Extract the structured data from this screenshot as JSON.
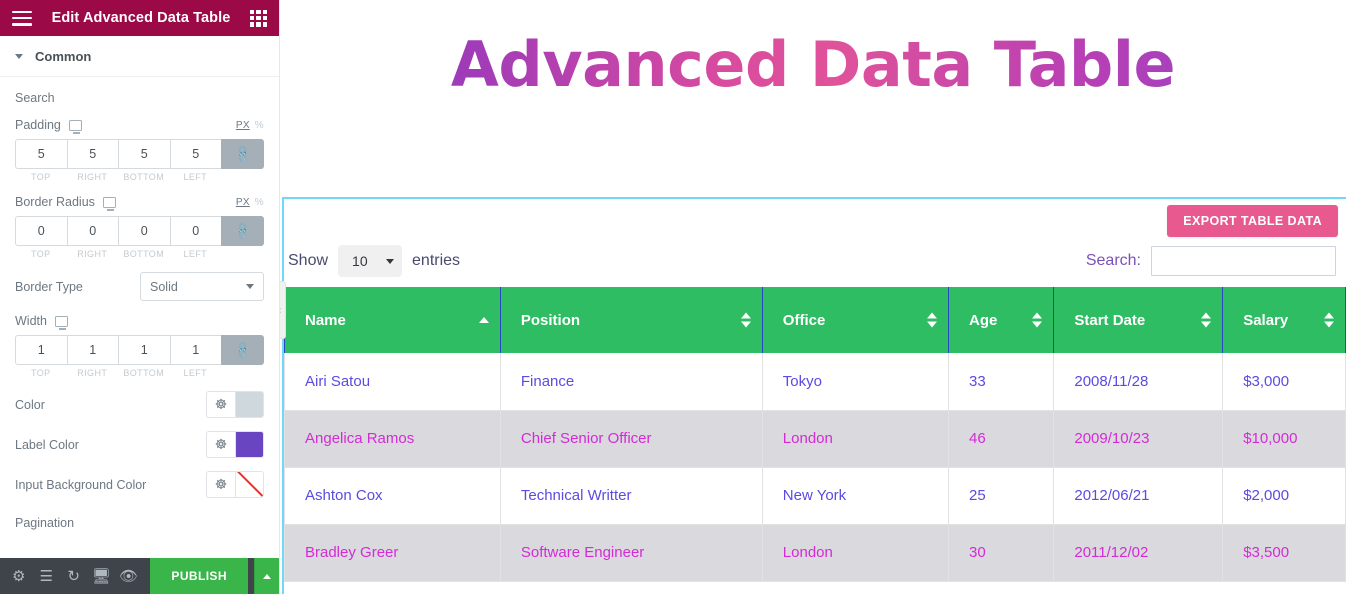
{
  "panel": {
    "title": "Edit Advanced Data Table",
    "menu_icon": "hamburger-icon",
    "grid_icon": "grid-icon",
    "section": {
      "label": "Common"
    },
    "groups": {
      "search": "Search",
      "pagination": "Pagination"
    },
    "controls": {
      "padding": {
        "label": "Padding",
        "unit_px": "PX",
        "unit_pct": "%",
        "values": [
          "5",
          "5",
          "5",
          "5"
        ],
        "sides": [
          "TOP",
          "RIGHT",
          "BOTTOM",
          "LEFT"
        ]
      },
      "border_radius": {
        "label": "Border Radius",
        "unit_px": "PX",
        "unit_pct": "%",
        "values": [
          "0",
          "0",
          "0",
          "0"
        ],
        "sides": [
          "TOP",
          "RIGHT",
          "BOTTOM",
          "LEFT"
        ]
      },
      "border_type": {
        "label": "Border Type",
        "value": "Solid"
      },
      "width": {
        "label": "Width",
        "values": [
          "1",
          "1",
          "1",
          "1"
        ],
        "sides": [
          "TOP",
          "RIGHT",
          "BOTTOM",
          "LEFT"
        ]
      },
      "color": {
        "label": "Color",
        "swatch": "#cfd8dd"
      },
      "label_color": {
        "label": "Label Color",
        "swatch": "#6a45c2"
      },
      "input_bg_color": {
        "label": "Input Background Color",
        "swatch": "transparent"
      }
    },
    "footer": {
      "icons": [
        "gear-icon",
        "layers-icon",
        "history-icon",
        "responsive-icon",
        "eye-icon"
      ],
      "publish_label": "PUBLISH"
    }
  },
  "canvas": {
    "heading": "Advanced Data Table",
    "collapse_handle": "‹",
    "export_button": "EXPORT TABLE DATA",
    "show_label": "Show",
    "entries_value": "10",
    "entries_label": "entries",
    "search_label": "Search:",
    "search_value": "",
    "table": {
      "headers": [
        {
          "label": "Name",
          "sort": "asc"
        },
        {
          "label": "Position",
          "sort": "none"
        },
        {
          "label": "Office",
          "sort": "none"
        },
        {
          "label": "Age",
          "sort": "none"
        },
        {
          "label": "Start Date",
          "sort": "none"
        },
        {
          "label": "Salary",
          "sort": "none"
        }
      ],
      "rows": [
        {
          "name": "Airi Satou",
          "position": "Finance",
          "office": "Tokyo",
          "age": "33",
          "start_date": "2008/11/28",
          "salary": "$3,000"
        },
        {
          "name": "Angelica Ramos",
          "position": "Chief Senior Officer",
          "office": "London",
          "age": "46",
          "start_date": "2009/10/23",
          "salary": "$10,000"
        },
        {
          "name": "Ashton Cox",
          "position": "Technical Writter",
          "office": "New York",
          "age": "25",
          "start_date": "2012/06/21",
          "salary": "$2,000"
        },
        {
          "name": "Bradley Greer",
          "position": "Software Engineer",
          "office": "London",
          "age": "30",
          "start_date": "2011/12/02",
          "salary": "$3,500"
        }
      ]
    }
  },
  "colors": {
    "panel_header": "#9b0a46",
    "table_header": "#2ebd63",
    "export_btn": "#e8598f",
    "publish": "#39b54a",
    "odd_text": "#5b4be0",
    "even_text": "#d42bd6",
    "widget_outline": "#71d7f7"
  }
}
